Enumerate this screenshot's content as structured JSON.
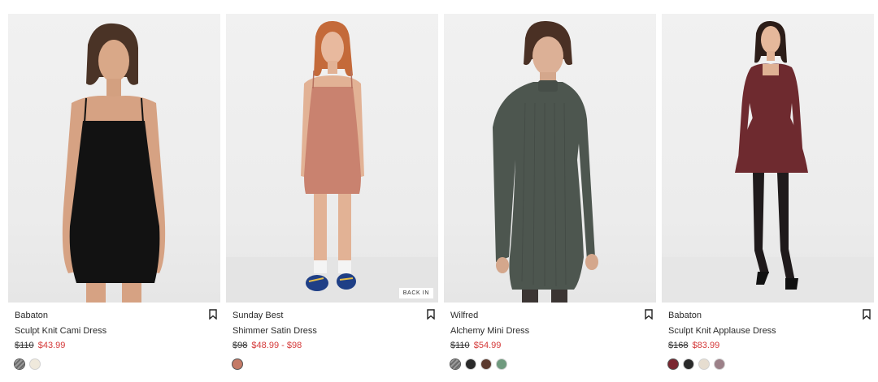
{
  "products": [
    {
      "brand": "Babaton",
      "name": "Sculpt Knit Cami Dress",
      "original_price": "$110",
      "sale_price": "$43.99",
      "badge": "",
      "image_icon": "model-black-cami-dress",
      "swatches": [
        {
          "color": "#7a7a7a",
          "pattern": "striped"
        },
        {
          "color": "#efe9dc",
          "pattern": "solid"
        }
      ]
    },
    {
      "brand": "Sunday Best",
      "name": "Shimmer Satin Dress",
      "original_price": "$98",
      "sale_price": "$48.99 - $98",
      "badge": "BACK IN",
      "image_icon": "model-rose-satin-dress",
      "swatches": [
        {
          "color": "#c47a66",
          "pattern": "solid"
        }
      ]
    },
    {
      "brand": "Wilfred",
      "name": "Alchemy Mini Dress",
      "original_price": "$110",
      "sale_price": "$54.99",
      "badge": "",
      "image_icon": "model-green-knit-dress",
      "swatches": [
        {
          "color": "#7a7a7a",
          "pattern": "striped"
        },
        {
          "color": "#2a2a2a",
          "pattern": "solid"
        },
        {
          "color": "#5b3a2e",
          "pattern": "solid"
        },
        {
          "color": "#6f9a7e",
          "pattern": "solid"
        }
      ]
    },
    {
      "brand": "Babaton",
      "name": "Sculpt Knit Applause Dress",
      "original_price": "$168",
      "sale_price": "$83.99",
      "badge": "",
      "image_icon": "model-burgundy-flare-dress",
      "swatches": [
        {
          "color": "#7a2630",
          "pattern": "solid"
        },
        {
          "color": "#2a2a2a",
          "pattern": "solid"
        },
        {
          "color": "#e6ddd0",
          "pattern": "solid"
        },
        {
          "color": "#9c8088",
          "pattern": "solid"
        }
      ]
    }
  ]
}
